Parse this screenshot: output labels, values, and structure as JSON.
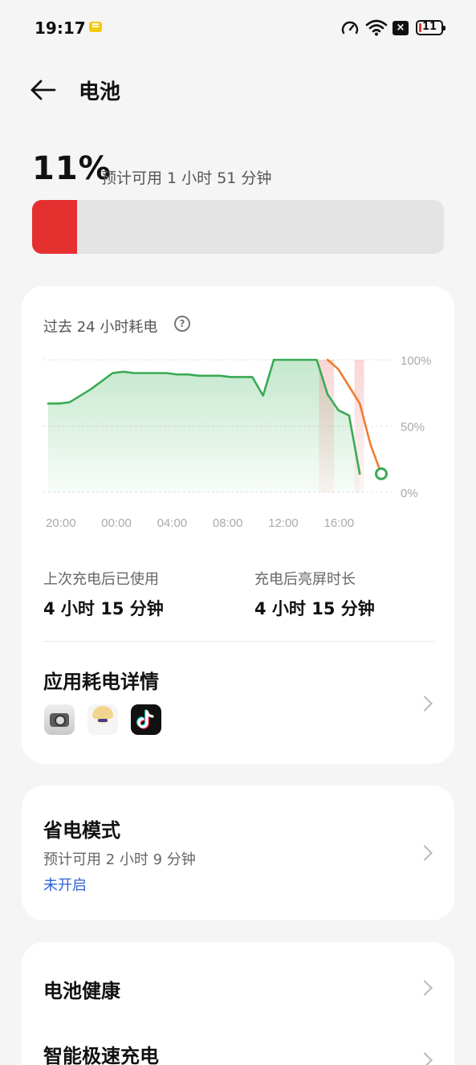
{
  "status_bar": {
    "time": "19:17",
    "battery_level": "11",
    "close_badge": "×",
    "icons": [
      "notification-icon",
      "speedometer-icon",
      "wifi-icon",
      "close-badge-icon",
      "battery-icon"
    ]
  },
  "header": {
    "title": "电池",
    "back_icon": "back-arrow-icon"
  },
  "battery": {
    "percent": "11%",
    "estimate": "预计可用 1 小时 51 分钟",
    "level_fraction": 0.11,
    "level_color": "#e53030"
  },
  "usage": {
    "title": "过去 24 小时耗电",
    "help_icon": "?",
    "chart_data": {
      "type": "area",
      "x_ticks": [
        "20:00",
        "00:00",
        "04:00",
        "08:00",
        "12:00",
        "16:00"
      ],
      "y_ticks": [
        "100%",
        "50%",
        "0%"
      ],
      "ylim": [
        0,
        100
      ],
      "grid": true,
      "series": [
        {
          "color": "#3aaa55",
          "x": [
            0,
            1,
            2,
            3,
            4,
            5,
            6,
            7,
            8,
            9,
            10,
            11,
            12,
            13,
            14,
            15,
            16,
            17,
            18,
            19,
            20,
            21
          ],
          "values": [
            67,
            67,
            68,
            73,
            78,
            84,
            90,
            91,
            90,
            90,
            90,
            90,
            89,
            89,
            88,
            88,
            88,
            87,
            87,
            87,
            73,
            100
          ]
        },
        {
          "color": "#3aaa55",
          "x": [
            21,
            22,
            23,
            24,
            25,
            26,
            27,
            28,
            29
          ],
          "values": [
            100,
            100,
            100,
            100,
            100,
            74,
            62,
            58,
            14
          ]
        },
        {
          "color": "#ef7d2e",
          "x": [
            26,
            27,
            28,
            29,
            30,
            31
          ],
          "values": [
            100,
            93,
            80,
            67,
            36,
            14
          ]
        }
      ],
      "current_point": {
        "x": 31,
        "value": 14
      }
    },
    "stats": [
      {
        "label": "上次充电后已使用",
        "value": "4 小时 15 分钟"
      },
      {
        "label": "充电后亮屏时长",
        "value": "4 小时 15 分钟"
      }
    ],
    "app_detail_title": "应用耗电详情",
    "apps": [
      "camera-app-icon",
      "game-app-icon",
      "tiktok-app-icon"
    ]
  },
  "power_saver": {
    "title": "省电模式",
    "estimate": "预计可用 2 小时 9 分钟",
    "status": "未开启"
  },
  "more": {
    "battery_health": "电池健康",
    "smart_charging": "智能极速充电"
  }
}
